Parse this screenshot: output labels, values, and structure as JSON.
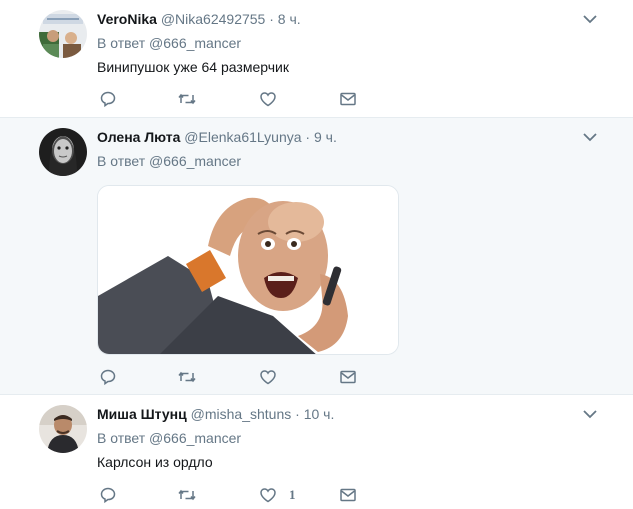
{
  "tweets": [
    {
      "name": "VeroNika",
      "handle": "@Nika62492755",
      "separator": "·",
      "time": "8 ч.",
      "reply_prefix": "В ответ",
      "reply_mention": "@666_mancer",
      "text": "Винипушок уже 64 размерчик",
      "like_count": ""
    },
    {
      "name": "Олена Люта",
      "handle": "@Elenka61Lyunya",
      "separator": "·",
      "time": "9 ч.",
      "reply_prefix": "В ответ",
      "reply_mention": "@666_mancer",
      "text": "",
      "like_count": ""
    },
    {
      "name": "Миша Штунц",
      "handle": "@misha_shtuns",
      "separator": "·",
      "time": "10 ч.",
      "reply_prefix": "В ответ",
      "reply_mention": "@666_mancer",
      "text": "Карлсон из ордло",
      "like_count": "1"
    }
  ],
  "icons": {
    "reply": "reply-icon",
    "retweet": "retweet-icon",
    "like": "heart-icon",
    "dm": "envelope-icon",
    "caret": "chevron-down-icon"
  },
  "colors": {
    "secondary_text": "#657786",
    "highlight_background": "#f5f8fa",
    "divider": "#e6ecf0"
  }
}
